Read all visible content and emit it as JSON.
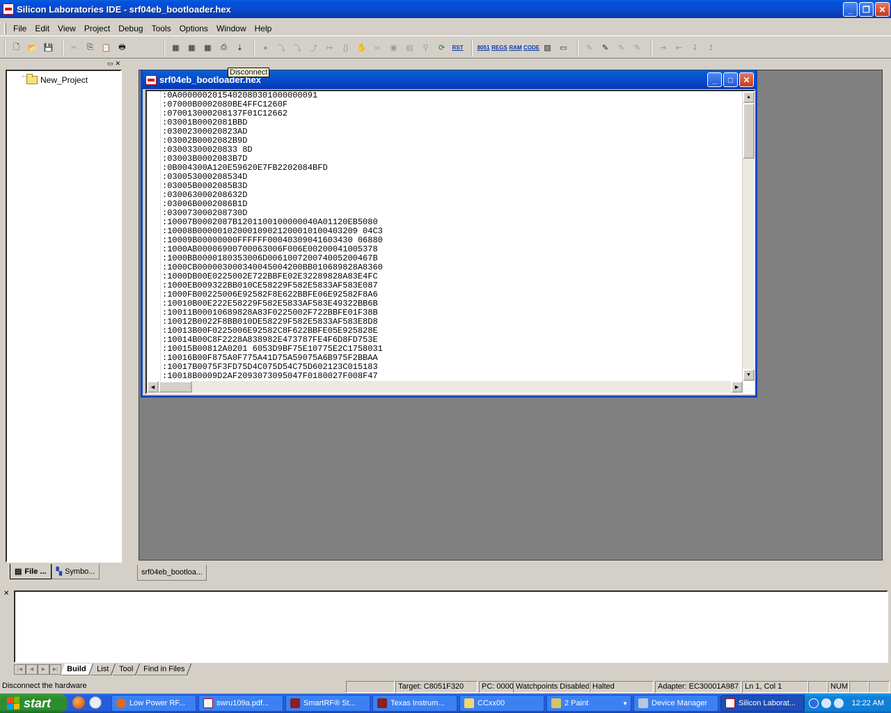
{
  "window": {
    "title": "Silicon Laboratories IDE - srf04eb_bootloader.hex"
  },
  "menu": [
    {
      "label": "File"
    },
    {
      "label": "Edit"
    },
    {
      "label": "View"
    },
    {
      "label": "Project"
    },
    {
      "label": "Debug"
    },
    {
      "label": "Tools"
    },
    {
      "label": "Options"
    },
    {
      "label": "Window"
    },
    {
      "label": "Help"
    }
  ],
  "tooltip": "Disconnect",
  "workspace": {
    "project_name": "New_Project",
    "tabs": [
      "File ...",
      "Symbo..."
    ]
  },
  "editor": {
    "title": "srf04eb_bootloader.hex",
    "lines": [
      ":0A0000002015402080301000000091",
      ":07000B0002080BE4FFC1260F",
      ":070013000208137F01C12662",
      ":03001B0002081BBD",
      ":03002300020823AD",
      ":03002B0002082B9D",
      ":03003300020833 8D",
      ":03003B0002083B7D",
      ":0B004300A120E59620E7FB2202084BFD",
      ":030053000208534D",
      ":03005B0002085B3D",
      ":030063000208632D",
      ":03006B0002086B1D",
      ":030073000208730D",
      ":10007B0002087B1201100100000040A01120EB5080",
      ":10008B00000102000109021200010100403209 04C3",
      ":10009B00000000FFFFFF00040309041603430 06880",
      ":1000AB00006900700063006F006E00200041005378",
      ":1000BB0000180353006D006100720074005200467B",
      ":1000CB000003000340045004200BB010689828A8360",
      ":1000DB00E0225002E722BBFE02E32289828A83E4FC",
      ":1000EB009322BB010CE58229F582E5833AF583E087",
      ":1000FB00225006E92582F8E622BBFE06E92582F8A6",
      ":10010B00E222E58229F582E5833AF583E49322BB6B",
      ":10011B00010689828A83F0225002F722BBFE01F38B",
      ":10012B0022F8BB010DE58229F582E5833AF583E8D8",
      ":10013B00F0225006E92582C8F622BBFE05E925828E",
      ":10014B00C8F2228A838982E473787FE4F6D8FD753E",
      ":10015B00812A0201 6053D9BF75E10775E2C1758031",
      ":10016B00F875A0F775A41D75A59075A6B975F2BBAA",
      ":10017B0075F3FD75D4C075D54C75D602123C015183",
      ":10018B0009D2AF2093073095047F0180027F008F47"
    ]
  },
  "mdi_tab": "srf04eb_bootloa...",
  "output": {
    "tabs": [
      "Build",
      "List",
      "Tool",
      "Find in Files"
    ],
    "active_tab": "Build"
  },
  "status": {
    "message": "Disconnect the hardware",
    "target": "Target: C8051F320",
    "pc": "PC: 0000",
    "watchpoints": "Watchpoints Disabled",
    "state": "Halted",
    "adapter": "Adapter: EC30001A987",
    "position": "Ln 1, Col 1",
    "num": "NUM"
  },
  "taskbar": {
    "start": "start",
    "tasks": [
      {
        "label": "Low Power RF..."
      },
      {
        "label": "swru109a.pdf..."
      },
      {
        "label": "SmartRF® St..."
      },
      {
        "label": "Texas Instrum..."
      },
      {
        "label": "CCxx00"
      },
      {
        "label": "2 Paint"
      },
      {
        "label": "Device Manager"
      },
      {
        "label": "Silicon Laborat..."
      }
    ],
    "clock": "12:22 AM"
  }
}
